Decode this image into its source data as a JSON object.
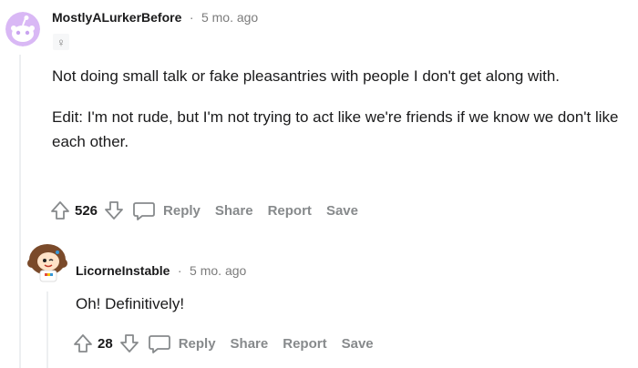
{
  "comments": [
    {
      "author": "MostlyALurkerBefore",
      "separator": "·",
      "age": "5 mo. ago",
      "flair": "♀",
      "paragraphs": [
        "Not doing small talk or fake pleasantries with people I don't get along with.",
        "Edit: I'm not rude, but I'm not trying to act like we're friends if we know we don't like each other."
      ],
      "votes": "526",
      "actions": {
        "reply": "Reply",
        "share": "Share",
        "report": "Report",
        "save": "Save"
      },
      "avatar_color": "#c9a3f0"
    },
    {
      "author": "LicorneInstable",
      "separator": "·",
      "age": "5 mo. ago",
      "paragraphs": [
        "Oh! Definitively!"
      ],
      "votes": "28",
      "actions": {
        "reply": "Reply",
        "share": "Share",
        "report": "Report",
        "save": "Save"
      }
    }
  ],
  "icons": {
    "upvote": "upvote-arrow-icon",
    "downvote": "downvote-arrow-icon",
    "reply": "speech-bubble-icon"
  },
  "colors": {
    "action_gray": "#878a8c",
    "text": "#1a1a1b",
    "thread_line": "#edeff1"
  }
}
